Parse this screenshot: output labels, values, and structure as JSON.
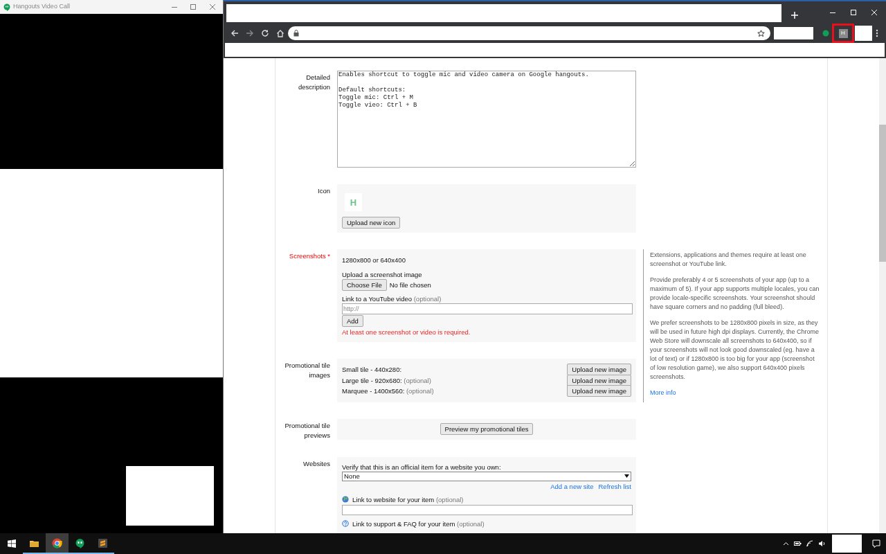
{
  "hangouts_window": {
    "title": "Hangouts Video Call"
  },
  "browser": {
    "forward_enabled": false,
    "extension_label": "H",
    "extension_highlighted": true
  },
  "form": {
    "sections": [
      {
        "kind": "textarea",
        "label": "Detailed description",
        "required": false,
        "value": "Enables shortcut to toggle mic and video camera on Google hangouts.\n\nDefault shortcuts:\nToggle mic: Ctrl + M\nToggle vieo: Ctrl + B"
      },
      {
        "kind": "icon",
        "label": "Icon",
        "required": false,
        "preview_letter": "H",
        "button": "Upload new icon"
      },
      {
        "kind": "screenshots",
        "label": "Screenshots",
        "required": true,
        "required_mark": "*",
        "sizes": "1280x800 or 640x400",
        "upload_label": "Upload a screenshot image",
        "file_button": "Choose File",
        "file_status": "No file chosen",
        "video_label": "Link to a YouTube video",
        "video_hint": "(optional)",
        "video_placeholder": "http://",
        "add_button": "Add",
        "error": "At least one screenshot or video is required.",
        "help": {
          "paragraphs": [
            "Extensions, applications and themes require at least one screenshot or YouTube link.",
            "Provide preferably 4 or 5 screenshots of your app (up to a maximum of 5). If your app supports multiple locales, you can provide locale-specific screenshots. Your screenshot should have square corners and no padding (full bleed).",
            "We prefer screenshots to be 1280x800 pixels in size, as they will be used in future high dpi displays. Currently, the Chrome Web Store will downscale all screenshots to 640x400, so if your screenshots will not look good downscaled (eg. have a lot of text) or if 1280x800 is too big for your app (screenshot of low resolution game), we also support 640x400 pixels screenshots."
          ],
          "link": "More info"
        }
      },
      {
        "kind": "tiles",
        "label": "Promotional tile images",
        "required": false,
        "tiles": [
          {
            "name": "Small tile - 440x280:",
            "button": "Upload new image"
          },
          {
            "name": "Large tile - 920x680:",
            "hint": "(optional)",
            "button": "Upload new image"
          },
          {
            "name": "Marquee - 1400x560:",
            "hint": "(optional)",
            "button": "Upload new image"
          }
        ]
      },
      {
        "kind": "preview",
        "label": "Promotional tile previews",
        "required": false,
        "button": "Preview my promotional tiles"
      },
      {
        "kind": "websites",
        "label": "Websites",
        "required": false,
        "verify_label": "Verify that this is an official item for a website you own:",
        "select_value": "None",
        "links": [
          "Add a new site",
          "Refresh list"
        ],
        "fields": [
          {
            "kind": "website",
            "label": "Link to website for your item",
            "hint": "(optional)"
          },
          {
            "kind": "support",
            "label": "Link to support & FAQ for your item",
            "hint": "(optional)"
          }
        ]
      }
    ]
  },
  "taskbar": {
    "apps": [
      {
        "kind": "files",
        "selected": false
      },
      {
        "kind": "browser",
        "selected": true
      },
      {
        "kind": "chat",
        "selected": false
      },
      {
        "kind": "editor",
        "selected": false
      }
    ]
  }
}
